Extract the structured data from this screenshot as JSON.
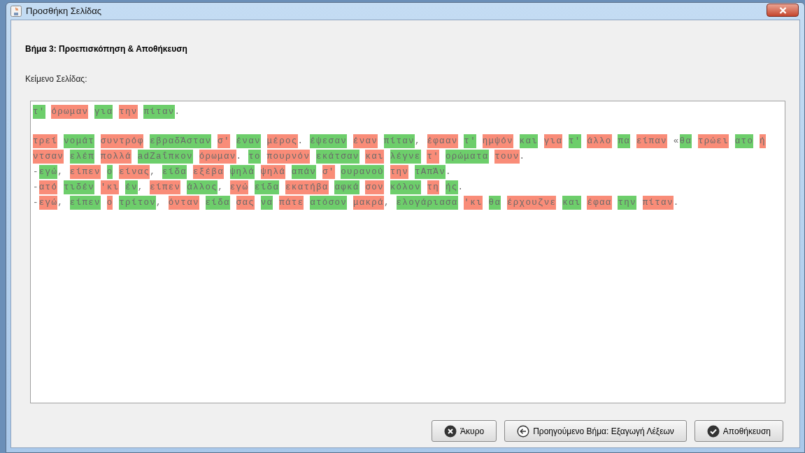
{
  "window": {
    "title": "Προσθήκη Σελίδας"
  },
  "heading": "Βήμα 3: Προεπισκόπηση & Αποθήκευση",
  "text_label": "Κείμενο Σελίδας:",
  "paragraphs": [
    {
      "lines": [
        [
          {
            "text": "τ'",
            "kind": "word",
            "color": "#6dce6b"
          },
          {
            "text": "όρωμαν",
            "kind": "word",
            "color": "#f98c78"
          },
          {
            "text": "για",
            "kind": "word",
            "color": "#6dce6b"
          },
          {
            "text": "την",
            "kind": "word",
            "color": "#f98c78"
          },
          {
            "text": "πίταν",
            "kind": "word",
            "color": "#6dce6b"
          },
          {
            "text": ".",
            "kind": "trail"
          }
        ]
      ]
    },
    {
      "lines": [
        [
          {
            "text": "τρεί",
            "kind": "word",
            "color": "#f98c78"
          },
          {
            "text": "νομάτ",
            "kind": "word",
            "color": "#6dce6b"
          },
          {
            "text": "συντρόφ",
            "kind": "word",
            "color": "#f98c78"
          },
          {
            "text": "εβραδΆσταν",
            "kind": "word",
            "color": "#6dce6b"
          },
          {
            "text": "σ'",
            "kind": "word",
            "color": "#f98c78"
          },
          {
            "text": "έναν",
            "kind": "word",
            "color": "#6dce6b"
          },
          {
            "text": "μέρος",
            "kind": "word",
            "color": "#f98c78"
          },
          {
            "text": ".",
            "kind": "trail"
          },
          {
            "text": "έψεσαν",
            "kind": "word",
            "color": "#6dce6b"
          },
          {
            "text": "έναν",
            "kind": "word",
            "color": "#f98c78"
          },
          {
            "text": "πίταν",
            "kind": "word",
            "color": "#6dce6b"
          },
          {
            "text": ",",
            "kind": "trail"
          },
          {
            "text": "έφααν",
            "kind": "word",
            "color": "#f98c78"
          },
          {
            "text": "τ'",
            "kind": "word",
            "color": "#6dce6b"
          },
          {
            "text": "ημψόν",
            "kind": "word",
            "color": "#f98c78"
          },
          {
            "text": "και",
            "kind": "word",
            "color": "#6dce6b"
          },
          {
            "text": "για",
            "kind": "word",
            "color": "#f98c78"
          },
          {
            "text": "τ'",
            "kind": "word",
            "color": "#6dce6b"
          },
          {
            "text": "άλλο",
            "kind": "word",
            "color": "#f98c78"
          },
          {
            "text": "πα",
            "kind": "word",
            "color": "#6dce6b"
          },
          {
            "text": "είπαν",
            "kind": "word",
            "color": "#f98c78"
          },
          {
            "text": "«",
            "kind": "lead"
          },
          {
            "text": "θα",
            "kind": "word",
            "color": "#6dce6b"
          },
          {
            "text": "τρώει",
            "kind": "word",
            "color": "#f98c78"
          },
          {
            "text": "ατο",
            "kind": "word",
            "color": "#6dce6b"
          },
          {
            "text": "ή",
            "kind": "word",
            "color": "#f98c78"
          }
        ],
        [
          {
            "text": "ντσαν",
            "kind": "word",
            "color": "#f98c78"
          },
          {
            "text": "ελέπ",
            "kind": "word",
            "color": "#6dce6b"
          },
          {
            "text": "πολλά",
            "kind": "word",
            "color": "#f98c78"
          },
          {
            "text": "adZaΐπκον",
            "kind": "word",
            "color": "#6dce6b"
          },
          {
            "text": "όρωμαν",
            "kind": "word",
            "color": "#f98c78"
          },
          {
            "text": ".",
            "kind": "trail"
          },
          {
            "text": "το",
            "kind": "word",
            "color": "#6dce6b"
          },
          {
            "text": "πουρνόν",
            "kind": "word",
            "color": "#f98c78"
          },
          {
            "text": "εκάτσαν",
            "kind": "word",
            "color": "#6dce6b"
          },
          {
            "text": "και",
            "kind": "word",
            "color": "#f98c78"
          },
          {
            "text": "λέγνε",
            "kind": "word",
            "color": "#6dce6b"
          },
          {
            "text": "τ'",
            "kind": "word",
            "color": "#f98c78"
          },
          {
            "text": "ορώματα",
            "kind": "word",
            "color": "#6dce6b"
          },
          {
            "text": "τουν",
            "kind": "word",
            "color": "#f98c78"
          },
          {
            "text": ".",
            "kind": "trail"
          }
        ],
        [
          {
            "text": "-",
            "kind": "lead"
          },
          {
            "text": "εγώ",
            "kind": "word",
            "color": "#6dce6b"
          },
          {
            "text": ",",
            "kind": "trail"
          },
          {
            "text": "είπεν",
            "kind": "word",
            "color": "#f98c78"
          },
          {
            "text": "ο",
            "kind": "word",
            "color": "#6dce6b"
          },
          {
            "text": "είνας",
            "kind": "word",
            "color": "#f98c78"
          },
          {
            "text": ",",
            "kind": "trail"
          },
          {
            "text": "είδα",
            "kind": "word",
            "color": "#6dce6b"
          },
          {
            "text": "εξέβα",
            "kind": "word",
            "color": "#f98c78"
          },
          {
            "text": "ψηλά",
            "kind": "word",
            "color": "#6dce6b"
          },
          {
            "text": "ψηλά",
            "kind": "word",
            "color": "#f98c78"
          },
          {
            "text": "απάν",
            "kind": "word",
            "color": "#6dce6b"
          },
          {
            "text": "σ'",
            "kind": "word",
            "color": "#f98c78"
          },
          {
            "text": "ουρανού",
            "kind": "word",
            "color": "#6dce6b"
          },
          {
            "text": "την",
            "kind": "word",
            "color": "#f98c78"
          },
          {
            "text": "τΑπΆν",
            "kind": "word",
            "color": "#6dce6b"
          },
          {
            "text": ".",
            "kind": "trail"
          }
        ],
        [
          {
            "text": "-",
            "kind": "lead"
          },
          {
            "text": "ατό",
            "kind": "word",
            "color": "#f98c78"
          },
          {
            "text": "τιδέν",
            "kind": "word",
            "color": "#6dce6b"
          },
          {
            "text": "'κι",
            "kind": "word",
            "color": "#f98c78"
          },
          {
            "text": "έν",
            "kind": "word",
            "color": "#6dce6b"
          },
          {
            "text": ",",
            "kind": "trail"
          },
          {
            "text": "είπεν",
            "kind": "word",
            "color": "#f98c78"
          },
          {
            "text": "άλλος",
            "kind": "word",
            "color": "#6dce6b"
          },
          {
            "text": ",",
            "kind": "trail"
          },
          {
            "text": "εγώ",
            "kind": "word",
            "color": "#f98c78"
          },
          {
            "text": "είδα",
            "kind": "word",
            "color": "#6dce6b"
          },
          {
            "text": "εκατήβα",
            "kind": "word",
            "color": "#f98c78"
          },
          {
            "text": "αφκά",
            "kind": "word",
            "color": "#6dce6b"
          },
          {
            "text": "σον",
            "kind": "word",
            "color": "#f98c78"
          },
          {
            "text": "κόλον",
            "kind": "word",
            "color": "#6dce6b"
          },
          {
            "text": "τη",
            "kind": "word",
            "color": "#f98c78"
          },
          {
            "text": "ής",
            "kind": "word",
            "color": "#6dce6b"
          },
          {
            "text": ".",
            "kind": "trail"
          }
        ],
        [
          {
            "text": "-",
            "kind": "lead"
          },
          {
            "text": "εγώ",
            "kind": "word",
            "color": "#f98c78"
          },
          {
            "text": ",",
            "kind": "trail"
          },
          {
            "text": "είπεν",
            "kind": "word",
            "color": "#6dce6b"
          },
          {
            "text": "ο",
            "kind": "word",
            "color": "#f98c78"
          },
          {
            "text": "τρίτον",
            "kind": "word",
            "color": "#6dce6b"
          },
          {
            "text": ",",
            "kind": "trail"
          },
          {
            "text": "όνταν",
            "kind": "word",
            "color": "#f98c78"
          },
          {
            "text": "είδα",
            "kind": "word",
            "color": "#6dce6b"
          },
          {
            "text": "σας",
            "kind": "word",
            "color": "#f98c78"
          },
          {
            "text": "να",
            "kind": "word",
            "color": "#6dce6b"
          },
          {
            "text": "πάτε",
            "kind": "word",
            "color": "#f98c78"
          },
          {
            "text": "ατόσον",
            "kind": "word",
            "color": "#6dce6b"
          },
          {
            "text": "μακρά",
            "kind": "word",
            "color": "#f98c78"
          },
          {
            "text": ",",
            "kind": "trail"
          },
          {
            "text": "ελογάριασα",
            "kind": "word",
            "color": "#6dce6b"
          },
          {
            "text": "'κι",
            "kind": "word",
            "color": "#f98c78"
          },
          {
            "text": "θα",
            "kind": "word",
            "color": "#6dce6b"
          },
          {
            "text": "έρχουζνε",
            "kind": "word",
            "color": "#f98c78"
          },
          {
            "text": "και",
            "kind": "word",
            "color": "#6dce6b"
          },
          {
            "text": "έφαα",
            "kind": "word",
            "color": "#f98c78"
          },
          {
            "text": "την",
            "kind": "word",
            "color": "#6dce6b"
          },
          {
            "text": "πίταν",
            "kind": "word",
            "color": "#f98c78"
          },
          {
            "text": ".",
            "kind": "trail"
          }
        ]
      ]
    }
  ],
  "buttons": [
    {
      "label": "Άκυρο",
      "kind": "cancel"
    },
    {
      "label": "Προηγούμενο Βήμα: Εξαγωγή Λέξεων",
      "kind": "back"
    },
    {
      "label": "Αποθήκευση",
      "kind": "save"
    }
  ]
}
